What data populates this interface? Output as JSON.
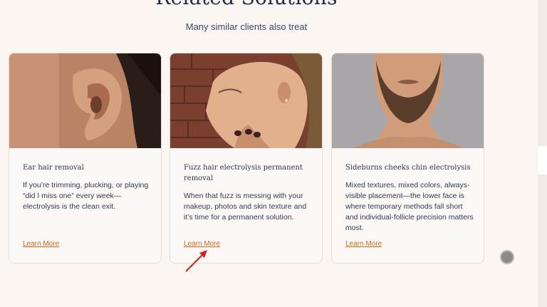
{
  "section": {
    "title": "Related Solutions",
    "subtitle": "Many similar clients also treat"
  },
  "cards": [
    {
      "image_label": "ear close-up photo",
      "title": "Ear hair removal",
      "description": "If you’re trimming, plucking, or playing “did I miss one” every week—electrolysis is the clean exit.",
      "link": "Learn More"
    },
    {
      "image_label": "woman face profile photo",
      "title": "Fuzz hair electrolysis permanent removal",
      "description": "When that fuzz is messing with your makeup, photos and skin texture and it’s time for a permanent solution.",
      "link": "Learn More"
    },
    {
      "image_label": "man bearded chin photo",
      "title": "Sideburns cheeks chin electrolysis",
      "description": "Mixed textures, mixed colors, always-visible placement—the lower face is where temporary methods fall short and individual-follicle precision matters most.",
      "link": "Learn More"
    }
  ],
  "colors": {
    "background": "#fbf6f2",
    "heading": "#1f2a44",
    "link": "#c56a18",
    "annotation_arrow": "#d0201e"
  }
}
